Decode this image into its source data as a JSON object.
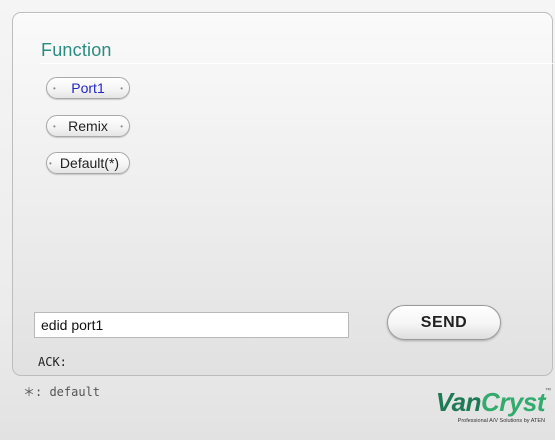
{
  "function_panel": {
    "title": "Function",
    "buttons": [
      {
        "label": "Port1",
        "active": true
      },
      {
        "label": "Remix",
        "active": false
      },
      {
        "label": "Default(*)",
        "active": false
      }
    ],
    "command_input": {
      "value": "edid port1",
      "placeholder": ""
    },
    "send_label": "SEND",
    "ack_label": "ACK:"
  },
  "footnote": "＊: default",
  "brand": {
    "logo_text_part1": "Van",
    "logo_text_part2": "Cryst",
    "trademark": "™",
    "tagline": "Professional A/V Solutions by ATEN"
  },
  "colors": {
    "title": "#2a8c80",
    "active_button_text": "#2424c8",
    "logo_dark": "#1e7a55",
    "logo_light": "#33aa6e"
  }
}
